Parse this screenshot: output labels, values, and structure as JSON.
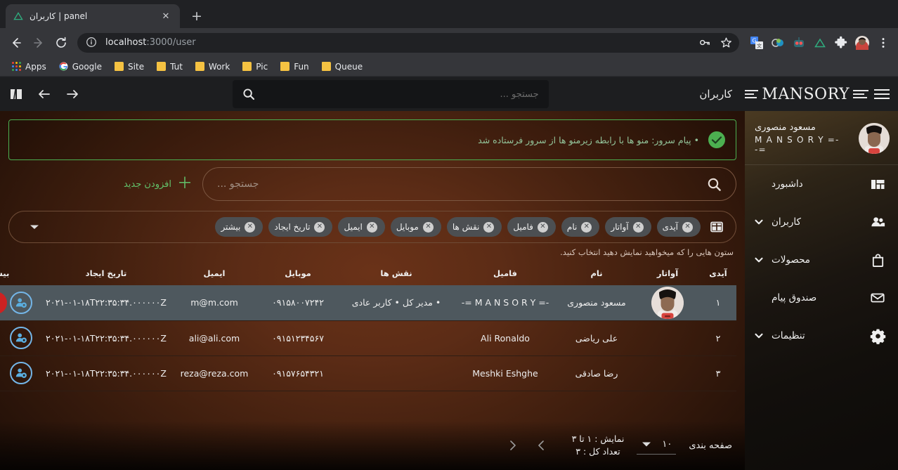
{
  "browser": {
    "tab": {
      "title": "panel | کاربران",
      "favicon": "nuxt-triangle-icon",
      "close_label": "✕"
    },
    "new_tab_label": "+",
    "nav": {
      "back": "←",
      "forward": "→",
      "reload": "⟳"
    },
    "omnibox": {
      "url_host": "localhost",
      "url_path": ":3000/user",
      "info_icon": "site-info-icon"
    },
    "omnibox_right": [
      "key-icon",
      "star-icon"
    ],
    "extensions": [
      "google-translate-icon",
      "colorpick-icon",
      "robot-icon",
      "nuxt-devtools-icon",
      "puzzle-extensions-icon",
      "profile-avatar-icon",
      "chrome-menu-icon"
    ],
    "bookmarks": [
      {
        "label": "Apps",
        "icon": "apps-grid-icon"
      },
      {
        "label": "Google",
        "icon": "google-icon"
      },
      {
        "label": "Site",
        "icon": "folder-icon"
      },
      {
        "label": "Tut",
        "icon": "folder-icon"
      },
      {
        "label": "Work",
        "icon": "folder-icon"
      },
      {
        "label": "Pic",
        "icon": "folder-icon"
      },
      {
        "label": "Fun",
        "icon": "folder-icon"
      },
      {
        "label": "Queue",
        "icon": "folder-icon"
      }
    ]
  },
  "appbar": {
    "title": "کاربران",
    "search_placeholder": "جستجو ...",
    "search_value": "",
    "icons": [
      "book-open-icon",
      "arrow-left-icon",
      "arrow-right-icon"
    ]
  },
  "sidebar": {
    "logo": "MANSORY",
    "burger": "menu-icon",
    "user": {
      "name": "مسعود منصوری",
      "subtitle": "-= M A N S O R Y =-"
    },
    "items": [
      {
        "label": "داشبورد",
        "icon": "dashboard-icon",
        "caret": false
      },
      {
        "label": "کاربران",
        "icon": "users-icon",
        "caret": true
      },
      {
        "label": "محصولات",
        "icon": "bag-icon",
        "caret": true
      },
      {
        "label": "صندوق پیام",
        "icon": "envelope-icon",
        "caret": false
      },
      {
        "label": "تنظیمات",
        "icon": "gear-icon",
        "caret": true
      }
    ]
  },
  "alert": {
    "text": "• پیام سرور: منو ها با رابطه زیرمنو ها از سرور فرستاده شد",
    "icon": "check-circle-icon",
    "color": "#4caf50"
  },
  "toolbar": {
    "add_new_label": "افزودن جدید",
    "add_new_icon": "plus-icon",
    "search_placeholder": "جستجو ...",
    "search_value": "",
    "search_icon": "search-icon"
  },
  "chips": {
    "grid_icon": "column-toggle-icon",
    "caret_icon": "chevron-down-icon",
    "items": [
      {
        "label": "آیدی"
      },
      {
        "label": "آواتار"
      },
      {
        "label": "نام"
      },
      {
        "label": "فامیل"
      },
      {
        "label": "نقش ها"
      },
      {
        "label": "موبایل"
      },
      {
        "label": "ایمیل"
      },
      {
        "label": "تاریخ ایجاد"
      },
      {
        "label": "بیشتر"
      }
    ]
  },
  "hint": "ستون هایی را که میخواهید نمایش دهید انتخاب کنید.",
  "table": {
    "headers": [
      "آیدی",
      "آواتار",
      "نام",
      "فامیل",
      "نقش ها",
      "موبایل",
      "ایمیل",
      "تاریخ ایجاد",
      "بیشتر"
    ],
    "rows": [
      {
        "id": "۱",
        "avatar": "user-photo",
        "name": "مسعود منصوری",
        "family": "-= M A N S O R Y =-",
        "roles": "• مدیر کل • کاربر عادی",
        "mobile": "۰۹۱۵۸۰۰۷۲۴۲",
        "email": "m@m.com",
        "date": "۲۰۲۱-۰۱-۱۸T۲۲:۳۵:۳۴.۰۰۰۰۰۰Z",
        "selected": true,
        "actions": [
          "user-settings-icon",
          "delete-icon",
          "edit-icon",
          "view-icon"
        ]
      },
      {
        "id": "۲",
        "avatar": "",
        "name": "علی ریاضی",
        "family": "Ali Ronaldo",
        "roles": "",
        "mobile": "۰۹۱۵۱۲۳۴۵۶۷",
        "email": "ali@ali.com",
        "date": "۲۰۲۱-۰۱-۱۸T۲۲:۳۵:۳۴.۰۰۰۰۰۰Z",
        "selected": false,
        "actions": [
          "user-settings-icon"
        ]
      },
      {
        "id": "۳",
        "avatar": "",
        "name": "رضا صادقی",
        "family": "Meshki Eshghe",
        "roles": "",
        "mobile": "۰۹۱۵۷۶۵۴۳۲۱",
        "email": "reza@reza.com",
        "date": "۲۰۲۱-۰۱-۱۸T۲۲:۳۵:۳۴.۰۰۰۰۰۰Z",
        "selected": false,
        "actions": [
          "user-settings-icon"
        ]
      }
    ]
  },
  "footer": {
    "label": "صفحه بندی",
    "page_size": "۱۰",
    "caret_icon": "chevron-down-icon",
    "info_line1": "نمایش : ۱ تا ۳",
    "info_line2": "تعداد کل : ۳",
    "prev_icon": "chevron-right-icon",
    "next_icon": "chevron-left-icon"
  },
  "colors": {
    "accent_green": "#62c16a",
    "chip_bg": "#4c4f52",
    "selected_row": "#4e585e",
    "delete": "#cc2222",
    "edit": "#34a047",
    "view": "#3b43c7",
    "content_brown": "#5c2c16"
  }
}
